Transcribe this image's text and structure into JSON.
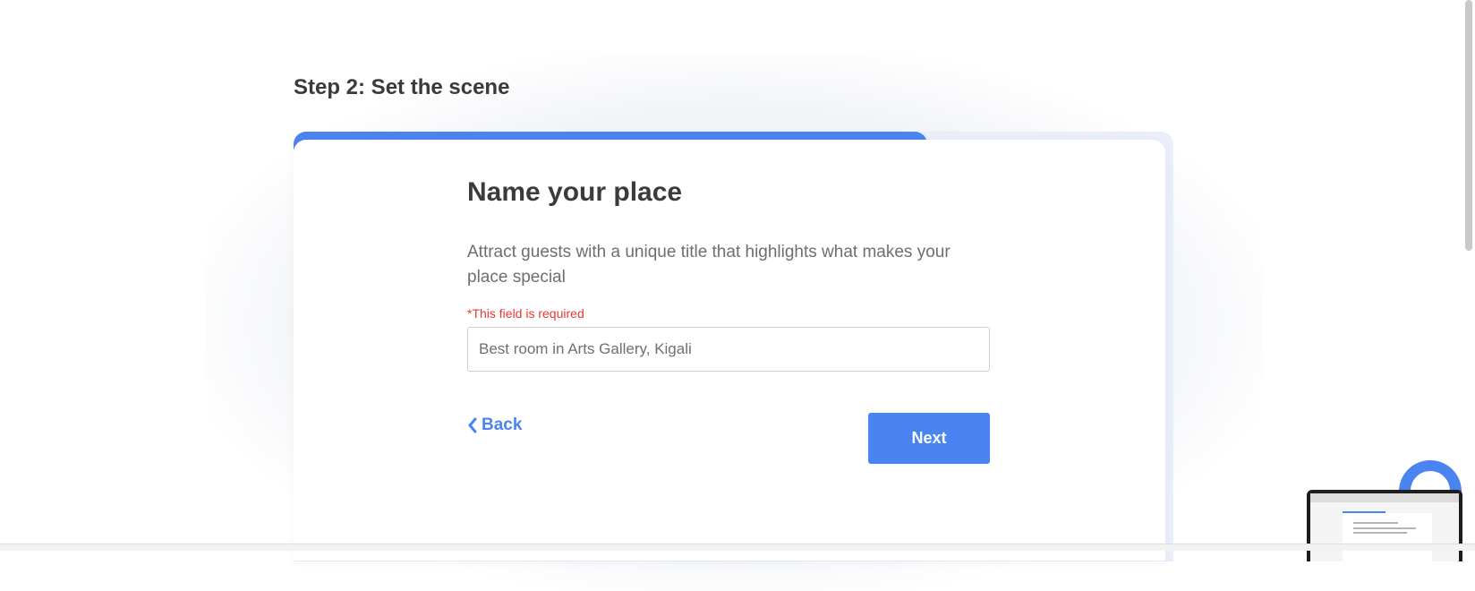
{
  "step": {
    "title": "Step 2: Set the scene"
  },
  "progress": {
    "fraction": 0.72
  },
  "form": {
    "heading": "Name your place",
    "description": "Attract guests with a unique title that highlights what makes your place special",
    "error": "*This field is required",
    "title_field": {
      "value": "",
      "placeholder": "Best room in Arts Gallery, Kigali"
    }
  },
  "nav": {
    "back_label": "Back",
    "back_icon": "chevron-left-icon",
    "next_label": "Next"
  },
  "widgets": {
    "chat_icon": "chat-bubble-icon"
  },
  "colors": {
    "accent": "#4a84f0",
    "error": "#e53935",
    "text": "#3b3b3b"
  }
}
